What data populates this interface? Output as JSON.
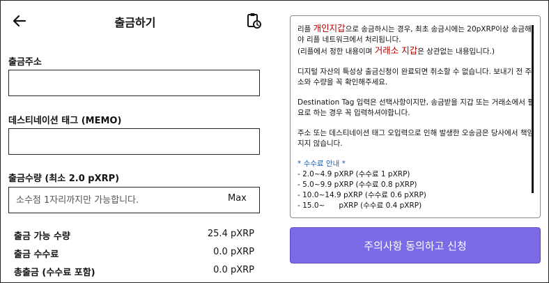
{
  "header": {
    "title": "출금하기"
  },
  "form": {
    "address_label": "출금주소",
    "address_value": "",
    "memo_label": "데스티네이션 태그 (MEMO)",
    "memo_value": "",
    "amount_label": "출금수량 (최소 2.0 pXRP)",
    "amount_placeholder": "소수점 1자리까지만 가능합니다.",
    "max_label": "Max"
  },
  "summary": [
    {
      "label": "출금 가능 수량",
      "value": "25.4 pXRP"
    },
    {
      "label": "출금 수수료",
      "value": "0.0 pXRP"
    },
    {
      "label": "총출금 (수수료 포함)",
      "value": "0.0 pXRP"
    }
  ],
  "notice": {
    "p1_a": "리플 ",
    "p1_red1": "개인지갑",
    "p1_b": "으로 송금하시는 경우, 최초 송금시에는 20pXRP이상 송금해야 리플 네트워크에서 처리됩니다.",
    "p1_c": "(리플에서 정한 내용이며 ",
    "p1_red2": "거래소 지갑",
    "p1_d": "은 상관없는 내용입니다.)",
    "p2": "디지털 자산의 특성상 출금신청이 완료되면 취소할 수 없습니다. 보내기 전 주소와 수량을 꼭 확인해주세요.",
    "p3": "Destination Tag 입력은 선택사항이지만, 송금받을 지갑 또는 거래소에서 필요로 하는 경우 꼭 입력하셔야합니다.",
    "p4": "주소 또는 데스티네이션 태그 오입력으로 인해 발생한 오송금은 당사에서 책임지지 않습니다.",
    "fee_title": "* 수수료 안내 *",
    "fees": [
      "- 2.0~4.9 pXRP (수수료 1 pXRP)",
      "- 5.0~9.9 pXRP (수수료 0.8 pXRP)",
      "- 10.0~14.9 pXRP (수수료 0.6 pXRP)",
      "- 15.0~      pXRP (수수료 0.4 pXRP)"
    ]
  },
  "apply_button": "주의사항 동의하고 신청",
  "colors": {
    "accent": "#7b6be6",
    "warning_red": "#b00000",
    "fee_blue": "#1f5fbf"
  },
  "icons": {
    "back": "arrow-left-icon",
    "history": "clipboard-clock-icon"
  }
}
